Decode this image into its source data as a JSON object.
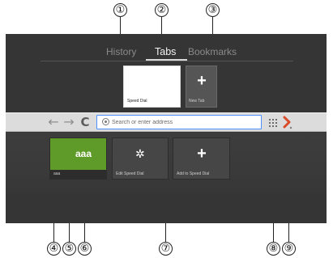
{
  "callouts": [
    "①",
    "②",
    "③",
    "④",
    "⑤",
    "⑥",
    "⑦",
    "⑧",
    "⑨"
  ],
  "top_tabs": {
    "history": "History",
    "tabs": "Tabs",
    "bookmarks": "Bookmarks"
  },
  "tab_thumbnails": {
    "speed_dial": "Speed Dial",
    "new_tab": "New Tab",
    "plus_symbol": "+"
  },
  "toolbar": {
    "back": "←",
    "forward": "→",
    "reload": "C",
    "address_placeholder": "Search or enter address"
  },
  "speed_dial": {
    "aaa_tile_text": "aaa",
    "aaa_label": "aaa",
    "edit_label": "Edit Speed Dial",
    "add_label": "Add to Speed Dial",
    "gear_symbol": "✲",
    "plus_symbol": "+"
  },
  "colors": {
    "screen_bg": "#353535",
    "toolbar_bg": "#dcdcdc",
    "address_focus": "#4d90fe",
    "green_tile": "#5f9b28",
    "menu_red": "#d94b2a"
  },
  "icons": {
    "back": "arrow-left-icon",
    "forward": "arrow-right-icon",
    "reload": "reload-icon",
    "address": "globe-icon",
    "grid": "grid-icon",
    "menu": "opera-menu-icon",
    "add": "plus-icon",
    "edit": "gear-icon"
  }
}
